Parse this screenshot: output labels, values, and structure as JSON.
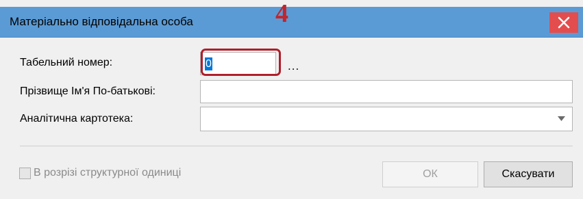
{
  "dialog": {
    "title": "Матеріально відповідальна особа",
    "annotation_number": "4",
    "close_icon": "close-icon"
  },
  "form": {
    "tab_number_label": "Табельний номер:",
    "tab_number_value": "0",
    "ellipsis_label": "...",
    "full_name_label": "Прізвище Ім'я По-батькові:",
    "full_name_value": "",
    "analytic_card_label": "Аналітична картотека:",
    "analytic_card_value": ""
  },
  "options": {
    "by_structural_unit_label": "В розрізі структурної одиниці",
    "by_structural_unit_checked": false
  },
  "buttons": {
    "ok_label": "ОК",
    "cancel_label": "Скасувати"
  },
  "colors": {
    "titlebar": "#5b9bd5",
    "close_button": "#e44d4d",
    "annotation": "#c0262f",
    "selection": "#0078d7"
  }
}
